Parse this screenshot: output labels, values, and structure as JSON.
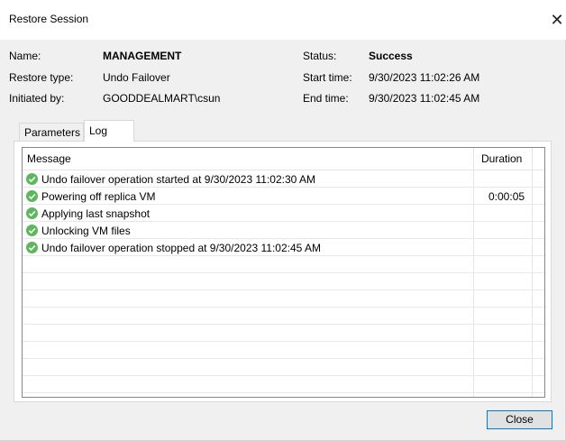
{
  "window": {
    "title": "Restore Session",
    "close_glyph": "✕"
  },
  "info": {
    "name_label": "Name:",
    "name_value": "MANAGEMENT",
    "restore_type_label": "Restore type:",
    "restore_type_value": "Undo Failover",
    "initiated_by_label": "Initiated by:",
    "initiated_by_value": "GOODDEALMART\\csun",
    "status_label": "Status:",
    "status_value": "Success",
    "start_time_label": "Start time:",
    "start_time_value": "9/30/2023 11:02:26 AM",
    "end_time_label": "End time:",
    "end_time_value": "9/30/2023 11:02:45 AM"
  },
  "tabs": [
    {
      "label": "Parameters",
      "active": false
    },
    {
      "label": "Log",
      "active": true
    }
  ],
  "log": {
    "columns": [
      "Message",
      "Duration"
    ],
    "rows": [
      {
        "icon": "success-check-icon",
        "message": "Undo failover operation started at 9/30/2023 11:02:30 AM",
        "duration": ""
      },
      {
        "icon": "success-check-icon",
        "message": "Powering off replica VM",
        "duration": "0:00:05"
      },
      {
        "icon": "success-check-icon",
        "message": "Applying last snapshot",
        "duration": ""
      },
      {
        "icon": "success-check-icon",
        "message": "Unlocking VM files",
        "duration": ""
      },
      {
        "icon": "success-check-icon",
        "message": "Undo failover operation stopped at 9/30/2023 11:02:45 AM",
        "duration": ""
      }
    ]
  },
  "footer": {
    "close_label": "Close"
  },
  "colors": {
    "success_green": "#5cb85c",
    "button_border": "#0078d7",
    "dialog_bg": "#f0f0f0"
  }
}
